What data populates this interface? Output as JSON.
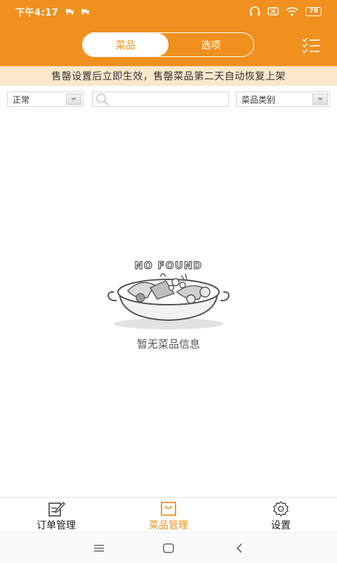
{
  "status_bar": {
    "time": "下午4:17",
    "battery": "78"
  },
  "header": {
    "tabs": [
      {
        "label": "菜品",
        "active": true
      },
      {
        "label": "选项",
        "active": false
      }
    ],
    "accent_color": "#f0901e"
  },
  "notice": {
    "text": "售罄设置后立即生效，售罄菜品第二天自动恢复上架"
  },
  "filters": {
    "status_select": "正常",
    "search_placeholder": "",
    "category_select": "菜品类别"
  },
  "empty_state": {
    "badge_text": "NO FOUND",
    "message": "暂无菜品信息"
  },
  "tab_bar": {
    "items": [
      {
        "label": "订单管理",
        "icon": "edit-document-icon",
        "active": false
      },
      {
        "label": "菜品管理",
        "icon": "shopping-bag-icon",
        "active": true
      },
      {
        "label": "设置",
        "icon": "gear-icon",
        "active": false
      }
    ]
  },
  "system_nav": {
    "icons": [
      "menu-icon",
      "home-icon",
      "back-icon"
    ]
  }
}
